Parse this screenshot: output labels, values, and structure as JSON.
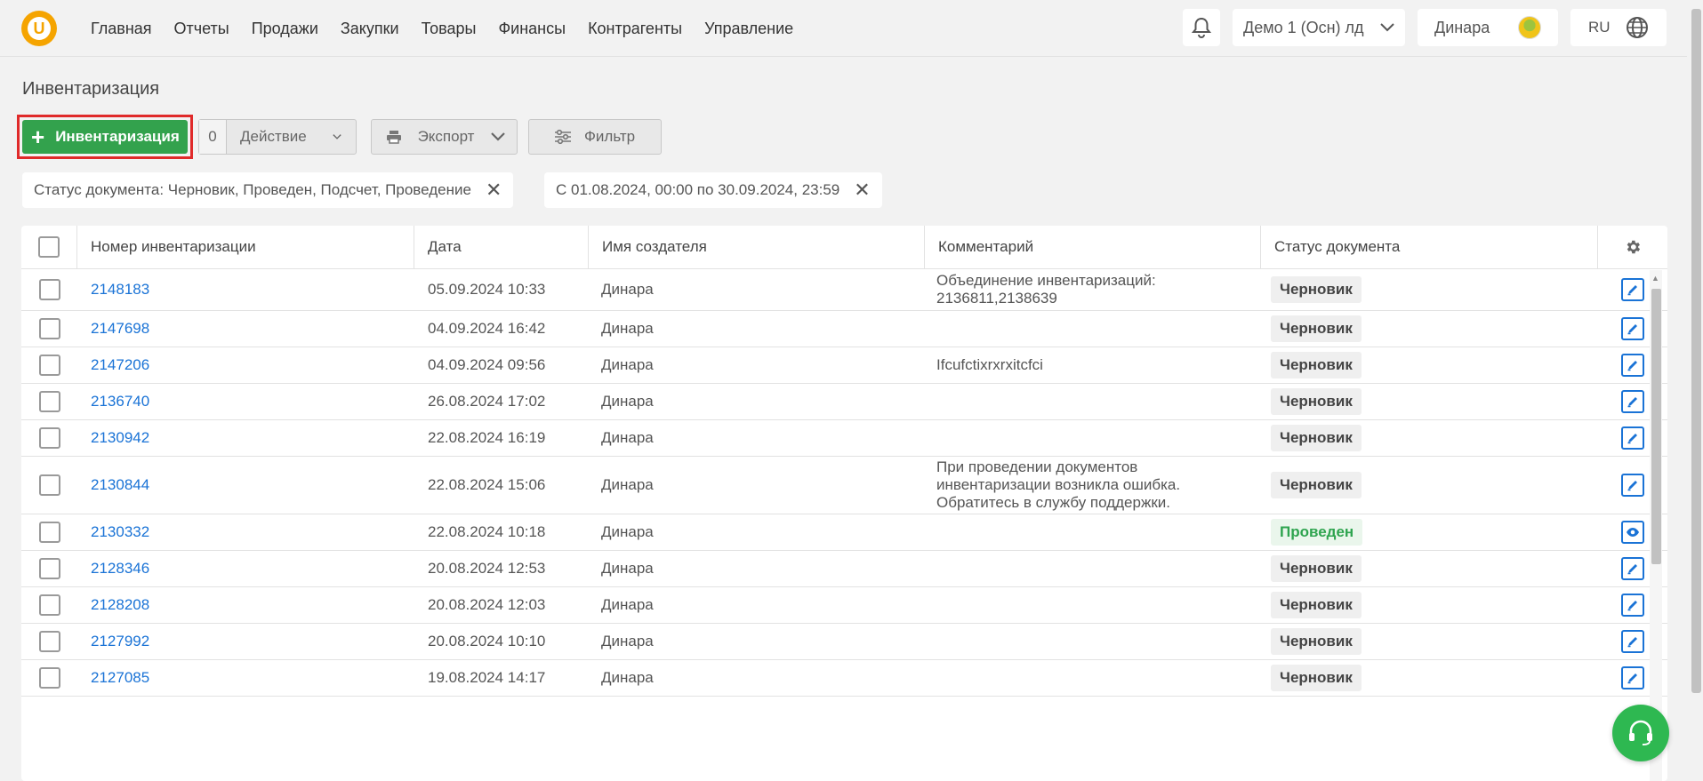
{
  "nav": {
    "logo_letter": "U",
    "items": [
      "Главная",
      "Отчеты",
      "Продажи",
      "Закупки",
      "Товары",
      "Финансы",
      "Контрагенты",
      "Управление"
    ],
    "org": "Демо 1 (Осн) лд",
    "user": "Динара",
    "lang": "RU"
  },
  "page": {
    "title": "Инвентаризация"
  },
  "toolbar": {
    "add_label": "Инвентаризация",
    "action_count": "0",
    "action_label": "Действие",
    "export_label": "Экспорт",
    "filter_label": "Фильтр"
  },
  "filters": [
    {
      "label": "Статус документа: Черновик, Проведен, Подсчет, Проведение"
    },
    {
      "label": "С 01.08.2024, 00:00 по 30.09.2024, 23:59"
    }
  ],
  "table": {
    "headers": [
      "Номер инвентаризации",
      "Дата",
      "Имя создателя",
      "Комментарий",
      "Статус документа"
    ],
    "rows": [
      {
        "num": "2148183",
        "date": "05.09.2024 10:33",
        "creator": "Динара",
        "comment": "Объединение инвентаризаций: 2136811,2138639",
        "status": "Черновик",
        "action": "edit"
      },
      {
        "num": "2147698",
        "date": "04.09.2024 16:42",
        "creator": "Динара",
        "comment": "",
        "status": "Черновик",
        "action": "edit"
      },
      {
        "num": "2147206",
        "date": "04.09.2024 09:56",
        "creator": "Динара",
        "comment": "Ifcufctixrxrxitcfci",
        "status": "Черновик",
        "action": "edit"
      },
      {
        "num": "2136740",
        "date": "26.08.2024 17:02",
        "creator": "Динара",
        "comment": "",
        "status": "Черновик",
        "action": "edit"
      },
      {
        "num": "2130942",
        "date": "22.08.2024 16:19",
        "creator": "Динара",
        "comment": "",
        "status": "Черновик",
        "action": "edit"
      },
      {
        "num": "2130844",
        "date": "22.08.2024 15:06",
        "creator": "Динара",
        "comment": "При проведении документов инвентаризации возникла ошибка. Обратитесь в службу поддержки.",
        "status": "Черновик",
        "action": "edit"
      },
      {
        "num": "2130332",
        "date": "22.08.2024 10:18",
        "creator": "Динара",
        "comment": "",
        "status": "Проведен",
        "action": "view"
      },
      {
        "num": "2128346",
        "date": "20.08.2024 12:53",
        "creator": "Динара",
        "comment": "",
        "status": "Черновик",
        "action": "edit"
      },
      {
        "num": "2128208",
        "date": "20.08.2024 12:03",
        "creator": "Динара",
        "comment": "",
        "status": "Черновик",
        "action": "edit"
      },
      {
        "num": "2127992",
        "date": "20.08.2024 10:10",
        "creator": "Динара",
        "comment": "",
        "status": "Черновик",
        "action": "edit"
      },
      {
        "num": "2127085",
        "date": "19.08.2024 14:17",
        "creator": "Динара",
        "comment": "",
        "status": "Черновик",
        "action": "edit"
      }
    ]
  },
  "colors": {
    "accent_green": "#33a24d",
    "link_blue": "#1a73d6",
    "logo_orange": "#f5a400",
    "highlight_red": "#e02a2a"
  }
}
